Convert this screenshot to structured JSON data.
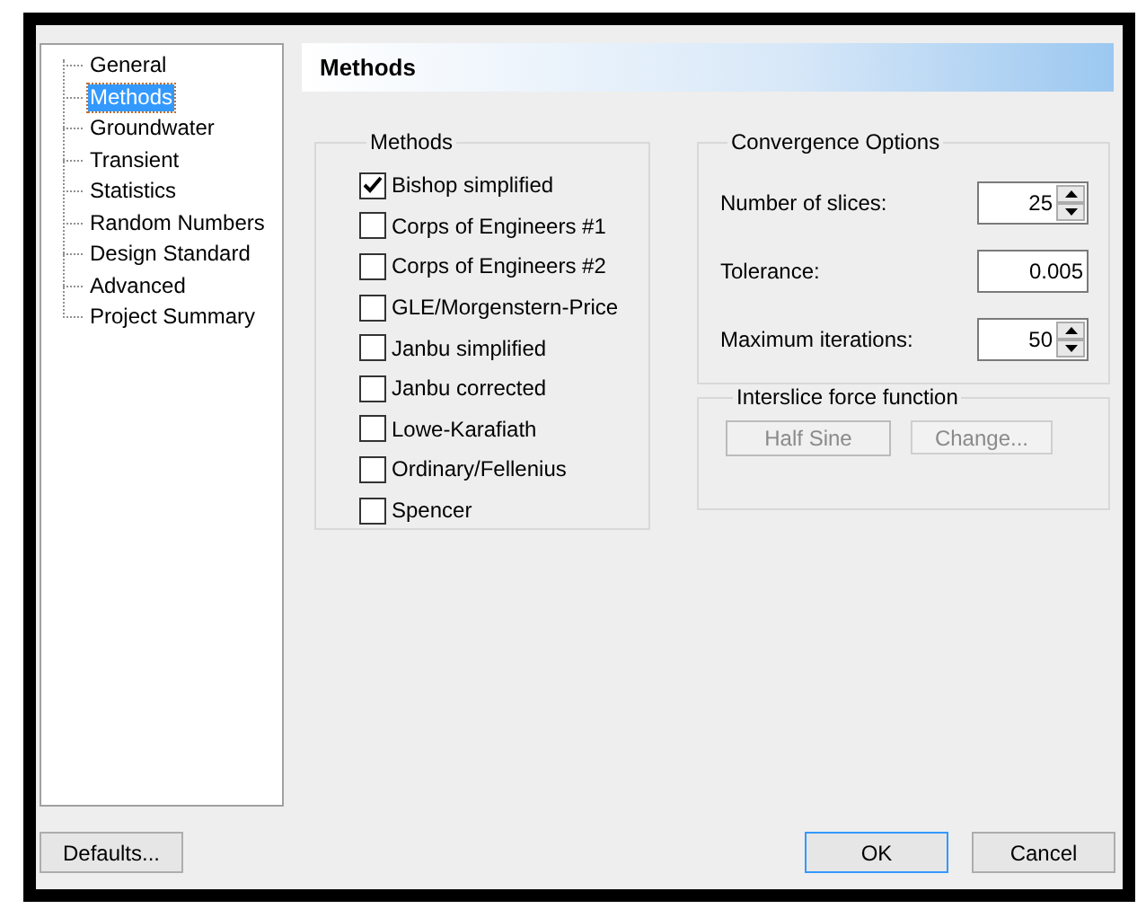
{
  "tree": {
    "items": [
      {
        "label": "General",
        "selected": false
      },
      {
        "label": "Methods",
        "selected": true
      },
      {
        "label": "Groundwater",
        "selected": false
      },
      {
        "label": "Transient",
        "selected": false
      },
      {
        "label": "Statistics",
        "selected": false
      },
      {
        "label": "Random Numbers",
        "selected": false
      },
      {
        "label": "Design Standard",
        "selected": false
      },
      {
        "label": "Advanced",
        "selected": false
      },
      {
        "label": "Project Summary",
        "selected": false
      }
    ]
  },
  "header": {
    "title": "Methods"
  },
  "methods": {
    "title": "Methods",
    "options": [
      {
        "label": "Bishop simplified",
        "checked": true
      },
      {
        "label": "Corps of Engineers #1",
        "checked": false
      },
      {
        "label": "Corps of Engineers #2",
        "checked": false
      },
      {
        "label": "GLE/Morgenstern-Price",
        "checked": false
      },
      {
        "label": "Janbu simplified",
        "checked": false
      },
      {
        "label": "Janbu corrected",
        "checked": false
      },
      {
        "label": "Lowe-Karafiath",
        "checked": false
      },
      {
        "label": "Ordinary/Fellenius",
        "checked": false
      },
      {
        "label": "Spencer",
        "checked": false
      }
    ]
  },
  "convergence": {
    "title": "Convergence Options",
    "fields": [
      {
        "kind": "spinner",
        "label": "Number of slices:",
        "value": "25"
      },
      {
        "kind": "text",
        "label": "Tolerance:",
        "value": "0.005"
      },
      {
        "kind": "spinner",
        "label": "Maximum iterations:",
        "value": "50"
      }
    ]
  },
  "interslice": {
    "title": "Interslice force function",
    "function": {
      "value": "Half Sine",
      "disabled": true
    },
    "change_button": {
      "label": "Change...",
      "disabled": true
    }
  },
  "buttons": [
    {
      "label": "Defaults...",
      "default": false
    },
    {
      "label": "OK",
      "default": true
    },
    {
      "label": "Cancel",
      "default": false
    }
  ]
}
